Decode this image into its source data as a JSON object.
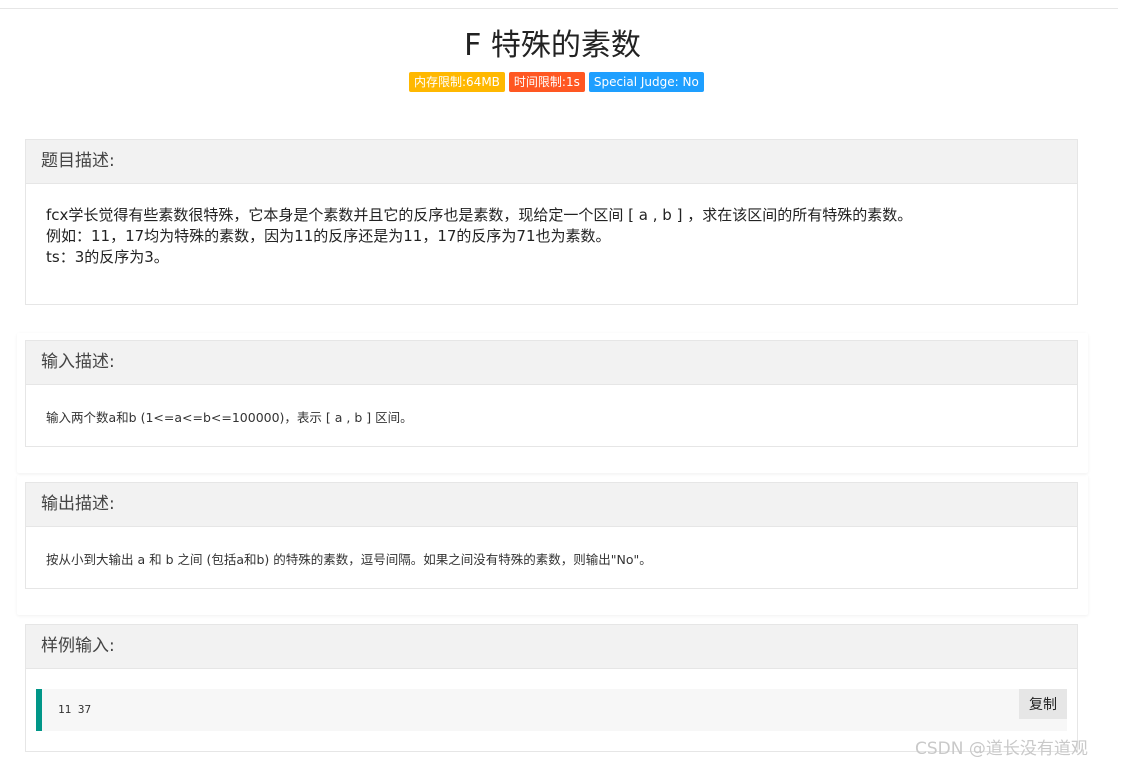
{
  "problem": {
    "title": "F 特殊的素数",
    "badges": [
      {
        "label": "内存限制:64MB",
        "color": "#FFB800"
      },
      {
        "label": "时间限制:1s",
        "color": "#FF5722"
      },
      {
        "label": "Special Judge: No",
        "color": "#1E9FFF"
      }
    ]
  },
  "description": {
    "heading": "题目描述:",
    "lines": [
      "fcx学长觉得有些素数很特殊，它本身是个素数并且它的反序也是素数，现给定一个区间 [ a , b ] ，求在该区间的所有特殊的素数。",
      "例如：11，17均为特殊的素数，因为11的反序还是为11，17的反序为71也为素数。",
      "ts：3的反序为3。"
    ]
  },
  "input": {
    "heading": "输入描述:",
    "text": "输入两个数a和b (1<=a<=b<=100000)，表示 [ a , b ] 区间。"
  },
  "output": {
    "heading": "输出描述:",
    "text": "按从小到大输出 a 和 b 之间 (包括a和b) 的特殊的素数，逗号间隔。如果之间没有特殊的素数，则输出\"No\"。"
  },
  "sample_input": {
    "heading": "样例输入:",
    "code": "11 37",
    "copy_label": "复制"
  },
  "watermark": "CSDN @道长没有道观",
  "colors": {
    "accent": "#009688",
    "panel_header": "#f2f2f2"
  }
}
